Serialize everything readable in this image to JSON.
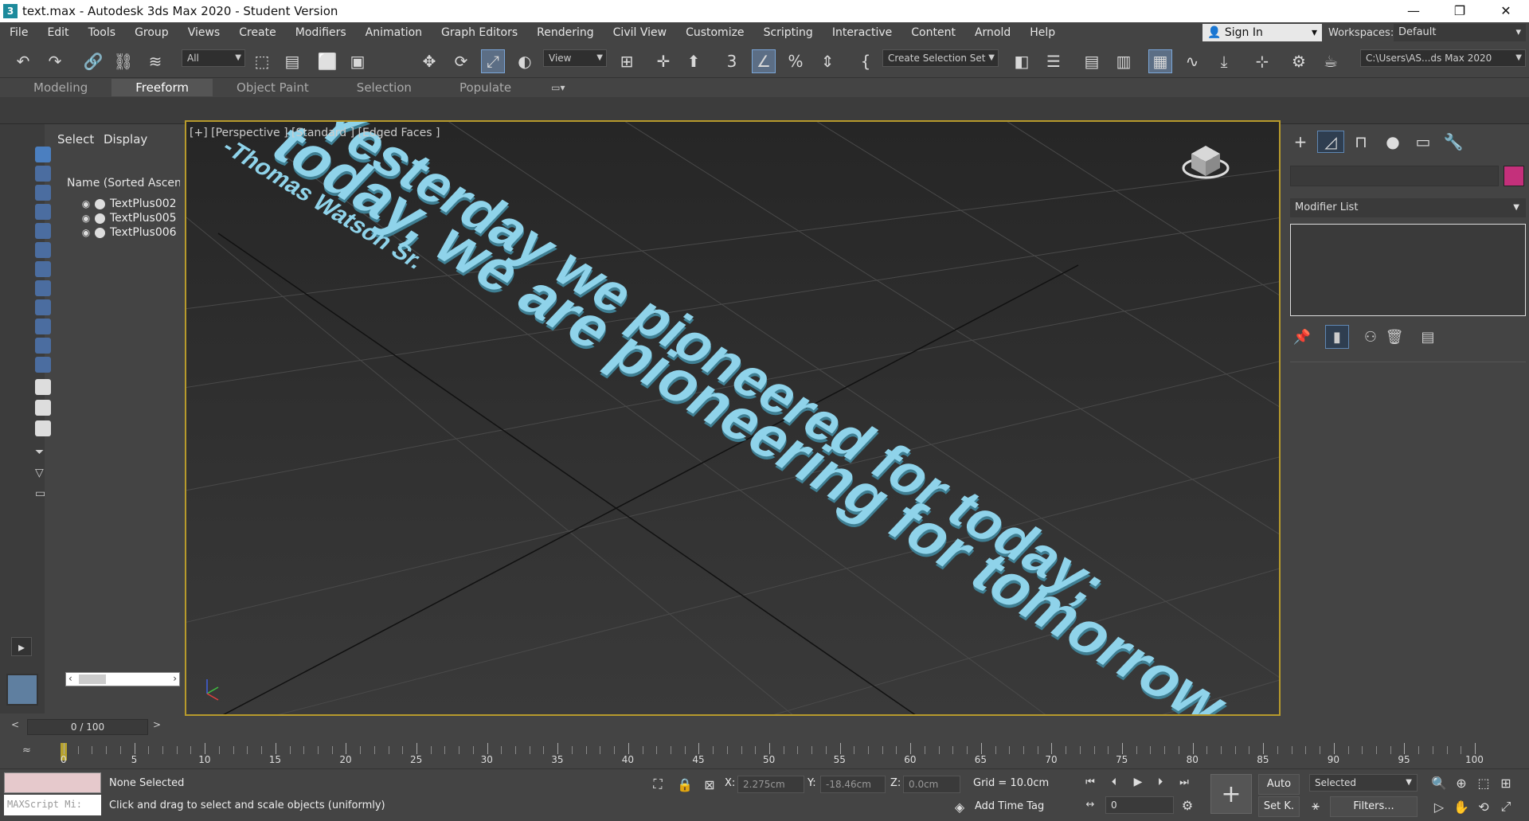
{
  "window": {
    "title": "text.max - Autodesk 3ds Max 2020 - Student Version",
    "app_icon": "3",
    "controls": [
      "—",
      "❐",
      "✕"
    ]
  },
  "menu": [
    "File",
    "Edit",
    "Tools",
    "Group",
    "Views",
    "Create",
    "Modifiers",
    "Animation",
    "Graph Editors",
    "Rendering",
    "Civil View",
    "Customize",
    "Scripting",
    "Interactive",
    "Content",
    "Arnold",
    "Help"
  ],
  "account": {
    "sign_in": "Sign In",
    "workspaces_label": "Workspaces:",
    "workspace_value": "Default"
  },
  "toolbar": {
    "filter_value": "All",
    "ref_coord_value": "View",
    "selection_set_value": "Create Selection Set",
    "project_path": "C:\\Users\\AS...ds Max 2020"
  },
  "ribbon": {
    "tabs": [
      "Modeling",
      "Freeform",
      "Object Paint",
      "Selection",
      "Populate"
    ],
    "active": "Freeform"
  },
  "scene_explorer": {
    "tabs": [
      "Select",
      "Display"
    ],
    "column_header": "Name (Sorted Ascending)",
    "objects": [
      "TextPlus002",
      "TextPlus005",
      "TextPlus006"
    ]
  },
  "viewport": {
    "label": "[+] [Perspective ] [Standard ] [Edged Faces ]",
    "text_lines": [
      "Yesterday we pioneered for today;",
      "today, we are pioneering for tomorrow. ”",
      "-Thomas Watson Sr."
    ],
    "text_color": "#8fd3ea",
    "border_color": "#b79a2c"
  },
  "command_panel": {
    "modifier_list": "Modifier List",
    "color_swatch": "#c4307b"
  },
  "time": {
    "slider": "0 / 100",
    "ticks": [
      "0",
      "5",
      "10",
      "15",
      "20",
      "25",
      "30",
      "35",
      "40",
      "45",
      "50",
      "55",
      "60",
      "65",
      "70",
      "75",
      "80",
      "85",
      "90",
      "95",
      "100"
    ]
  },
  "status": {
    "maxscript_placeholder": "MAXScript Mi:",
    "selection": "None Selected",
    "prompt": "Click and drag to select and scale objects (uniformly)",
    "x_label": "X:",
    "x_value": "2.275cm",
    "y_label": "Y:",
    "y_value": "-18.46cm",
    "z_label": "Z:",
    "z_value": "0.0cm",
    "grid": "Grid = 10.0cm",
    "add_time_tag": "Add Time Tag",
    "auto": "Auto",
    "set_key": "Set K.",
    "key_filter_value": "Selected",
    "filters": "Filters...",
    "frame_value": "0"
  }
}
